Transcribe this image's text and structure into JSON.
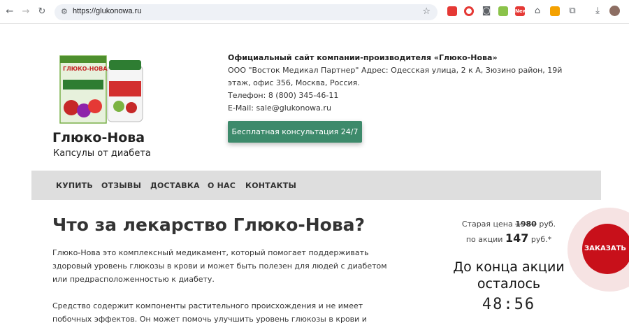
{
  "browser": {
    "url": "https://glukonowa.ru",
    "ext_badge": "New"
  },
  "header": {
    "brand_name": "Глюко-Нова",
    "brand_tagline": "Капсулы от диабета",
    "product_pack_label": "ГЛЮКО-НОВА",
    "company_title": "Официальный сайт компании-производителя «Глюко-Нова»",
    "company_address": "ООО \"Восток Медикал Партнер\" Адрес: Одесская улица, 2 к А, Зюзино район, 19й этаж, офис 356, Москва, Россия.",
    "company_phone": "Телефон: 8 (800) 345-46-11",
    "company_email": "E-Mail: sale@glukonowa.ru",
    "consult_button": "Бесплатная консультация 24/7"
  },
  "nav": {
    "items": [
      "КУПИТЬ",
      "ОТЗЫВЫ",
      "ДОСТАВКА",
      "О НАС",
      "КОНТАКТЫ"
    ]
  },
  "main": {
    "heading": "Что за лекарство Глюко-Нова?",
    "paragraph1": "Глюко-Нова это комплексный медикамент, который помогает поддерживать здоровый уровень глюкозы в крови и может быть полезен для людей с диабетом или предрасположенностью к диабету.",
    "paragraph2": "Средство содержит компоненты растительного происхождения и не имеет побочных эффектов. Он может помочь улучшить уровень глюкозы в крови и снизить риск развития"
  },
  "sidebar": {
    "old_price_prefix": "Старая цена",
    "old_price": "1980",
    "old_price_suffix": "руб.",
    "new_price_prefix": "по акции",
    "new_price": "147",
    "new_price_suffix": "руб.*",
    "countdown_label": "До конца акции осталось",
    "countdown": "48:56"
  },
  "order_button": "ЗАКАЗАТЬ",
  "colors": {
    "accent_green": "#3d8a6b",
    "order_red": "#c8101a",
    "nav_bg": "#dedede"
  }
}
